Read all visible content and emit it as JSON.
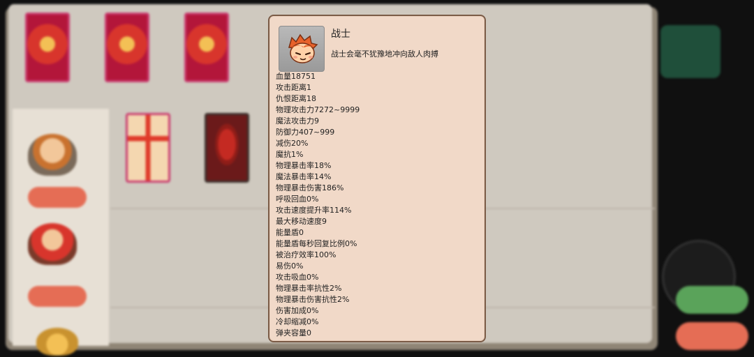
{
  "hero": {
    "name": "战士",
    "description": "战士会毫不犹豫地冲向敌人肉搏",
    "portrait_icon": "warrior-face-icon"
  },
  "stats": [
    "血量18751",
    "攻击距离1",
    "仇恨距离18",
    "物理攻击力7272~9999",
    "魔法攻击力9",
    "防御力407~999",
    "减伤20%",
    "魔抗1%",
    "物理暴击率18%",
    "魔法暴击率14%",
    "物理暴击伤害186%",
    "呼吸回血0%",
    "攻击速度提升率114%",
    "最大移动速度9",
    "能量盾0",
    "能量盾每秒回复比例0%",
    "被治疗效率100%",
    "易伤0%",
    "攻击吸血0%",
    "物理暴击率抗性2%",
    "物理暴击伤害抗性2%",
    "伤害加成0%",
    "冷却缩减0%",
    "弹夹容量0"
  ],
  "colors": {
    "panel_bg": "#f1d9c8",
    "panel_border": "#7a5b46",
    "accent_red": "#e56d55",
    "accent_green": "#5aa35a"
  }
}
